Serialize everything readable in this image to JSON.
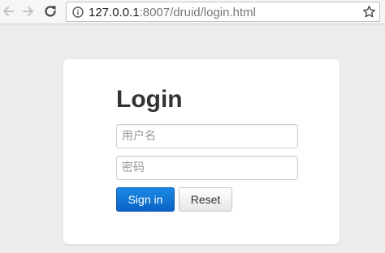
{
  "browser": {
    "url_host": "127.0.0.1",
    "url_rest": ":8007/druid/login.html",
    "icons": {
      "back": "back-arrow-icon",
      "forward": "forward-arrow-icon",
      "reload": "reload-icon",
      "info": "info-icon",
      "bookmark": "star-icon"
    }
  },
  "login": {
    "title": "Login",
    "username_placeholder": "用户名",
    "password_placeholder": "密码",
    "signin_label": "Sign in",
    "reset_label": "Reset"
  },
  "colors": {
    "primary": "#0a6fd6",
    "page_bg": "#ececec",
    "card_bg": "#ffffff"
  }
}
